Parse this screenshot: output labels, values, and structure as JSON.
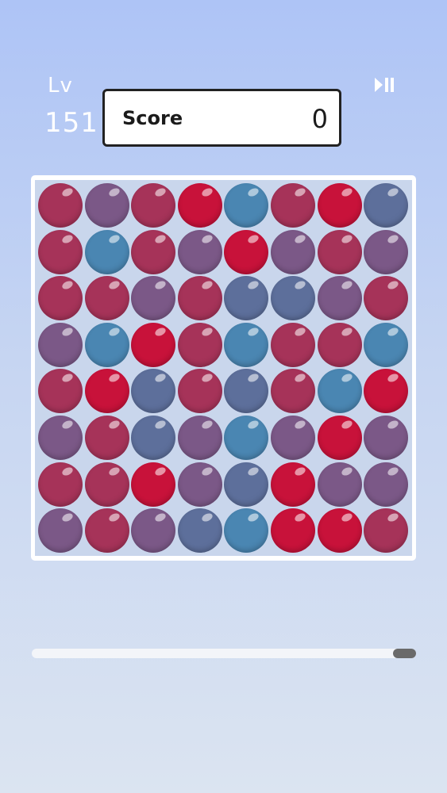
{
  "header": {
    "level_label": "Lv",
    "level_value": "151",
    "score_label": "Score",
    "score_value": "0",
    "play_pause_icon": "play-pause-icon"
  },
  "colors": {
    "R": "#c8123a",
    "M": "#a63359",
    "P": "#7b5887",
    "S": "#5d6f9b",
    "B": "#4a86b2"
  },
  "board": {
    "rows": 8,
    "cols": 8,
    "grid": [
      [
        "M",
        "P",
        "M",
        "R",
        "B",
        "M",
        "R",
        "S"
      ],
      [
        "M",
        "B",
        "M",
        "P",
        "R",
        "P",
        "M",
        "P"
      ],
      [
        "M",
        "M",
        "P",
        "M",
        "S",
        "S",
        "P",
        "M"
      ],
      [
        "P",
        "B",
        "R",
        "M",
        "B",
        "M",
        "M",
        "B"
      ],
      [
        "M",
        "R",
        "S",
        "M",
        "S",
        "M",
        "B",
        "R"
      ],
      [
        "P",
        "M",
        "S",
        "P",
        "B",
        "P",
        "R",
        "P"
      ],
      [
        "M",
        "M",
        "R",
        "P",
        "S",
        "R",
        "P",
        "P"
      ],
      [
        "P",
        "M",
        "P",
        "S",
        "B",
        "R",
        "R",
        "M"
      ]
    ]
  },
  "timer": {
    "remaining_fraction": 0.06
  }
}
